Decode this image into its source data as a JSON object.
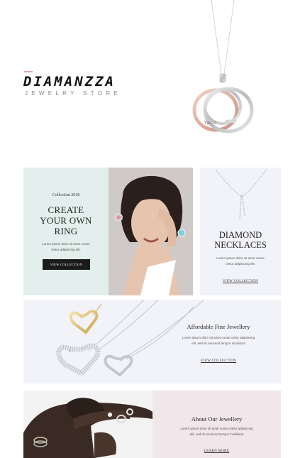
{
  "brand": {
    "logo": "DIAMANZZA",
    "tagline": "JEWELRY STORE",
    "accent": "#e6a6b4"
  },
  "hero": {
    "pendant_engraving": "T&CO"
  },
  "promo_ring": {
    "kicker": "Collection 2018",
    "title_line1": "CREATE",
    "title_line2": "YOUR OWN",
    "title_line3": "RING",
    "desc_line1": "Lorem ipsum dolor sit amet conse",
    "desc_line2": "ctetur adipisicing elit.",
    "button": "VIEW COLLECTION",
    "bg": "#e2efec"
  },
  "promo_diamond": {
    "title_line1": "DIAMOND",
    "title_line2": "NECKLACES",
    "desc_line1": "Lorem ipsum dolor sit amet conse",
    "desc_line2": "ctetur adipisicing elit.",
    "link": "VIEW COLLECTION",
    "bg": "#f2f3f8"
  },
  "promo_afford": {
    "title": "Affordable Fine Jewellery",
    "desc_line1": "Lorem ipsum dolor sit amet conse ctetur adipisicing",
    "desc_line2": "elit, sed do eiusmod tempor incididunt",
    "link": "VIEW COLLECTION"
  },
  "promo_about": {
    "title": "About Our Jewellery",
    "desc_line1": "Lorem ipsum dolor sit amet conse ctetur adipisicing",
    "desc_line2": "elit, sed do eiusmod tempor incididunt",
    "link": "LEARN MORE",
    "bg": "#f1e6ea"
  }
}
